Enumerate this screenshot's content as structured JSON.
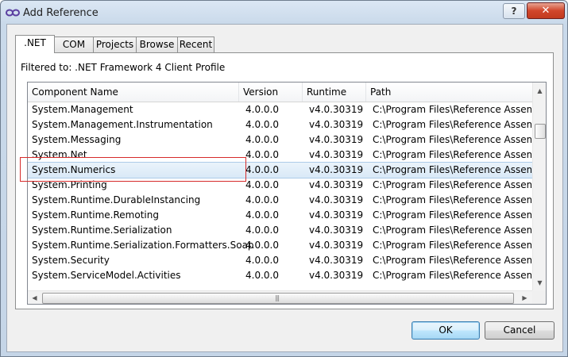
{
  "window": {
    "title": "Add Reference",
    "help": "?",
    "close": "✕"
  },
  "tabs": [
    ".NET",
    "COM",
    "Projects",
    "Browse",
    "Recent"
  ],
  "filter_text": "Filtered to: .NET Framework 4 Client Profile",
  "columns": [
    "Component Name",
    "Version",
    "Runtime",
    "Path"
  ],
  "rows": [
    {
      "name": "System.Management",
      "version": "4.0.0.0",
      "runtime": "v4.0.30319",
      "path": "C:\\Program Files\\Reference Assemb"
    },
    {
      "name": "System.Management.Instrumentation",
      "version": "4.0.0.0",
      "runtime": "v4.0.30319",
      "path": "C:\\Program Files\\Reference Assemb"
    },
    {
      "name": "System.Messaging",
      "version": "4.0.0.0",
      "runtime": "v4.0.30319",
      "path": "C:\\Program Files\\Reference Assemb"
    },
    {
      "name": "System.Net",
      "version": "4.0.0.0",
      "runtime": "v4.0.30319",
      "path": "C:\\Program Files\\Reference Assemb"
    },
    {
      "name": "System.Numerics",
      "version": "4.0.0.0",
      "runtime": "v4.0.30319",
      "path": "C:\\Program Files\\Reference Assemb"
    },
    {
      "name": "System.Printing",
      "version": "4.0.0.0",
      "runtime": "v4.0.30319",
      "path": "C:\\Program Files\\Reference Assemb"
    },
    {
      "name": "System.Runtime.DurableInstancing",
      "version": "4.0.0.0",
      "runtime": "v4.0.30319",
      "path": "C:\\Program Files\\Reference Assemb"
    },
    {
      "name": "System.Runtime.Remoting",
      "version": "4.0.0.0",
      "runtime": "v4.0.30319",
      "path": "C:\\Program Files\\Reference Assemb"
    },
    {
      "name": "System.Runtime.Serialization",
      "version": "4.0.0.0",
      "runtime": "v4.0.30319",
      "path": "C:\\Program Files\\Reference Assemb"
    },
    {
      "name": "System.Runtime.Serialization.Formatters.Soap",
      "version": "4.0.0.0",
      "runtime": "v4.0.30319",
      "path": "C:\\Program Files\\Reference Assemb"
    },
    {
      "name": "System.Security",
      "version": "4.0.0.0",
      "runtime": "v4.0.30319",
      "path": "C:\\Program Files\\Reference Assemb"
    },
    {
      "name": "System.ServiceModel.Activities",
      "version": "4.0.0.0",
      "runtime": "v4.0.30319",
      "path": "C:\\Program Files\\Reference Assemb"
    }
  ],
  "selected_row": 4,
  "buttons": {
    "ok": "OK",
    "cancel": "Cancel"
  },
  "scroll_arrows": {
    "up": "▲",
    "down": "▼",
    "left": "◀",
    "right": "▶",
    "grip": "|||"
  },
  "colors": {
    "accent_selection": "#d9e9f7",
    "highlight_box": "#d62b2b",
    "close_button": "#c9442b"
  }
}
